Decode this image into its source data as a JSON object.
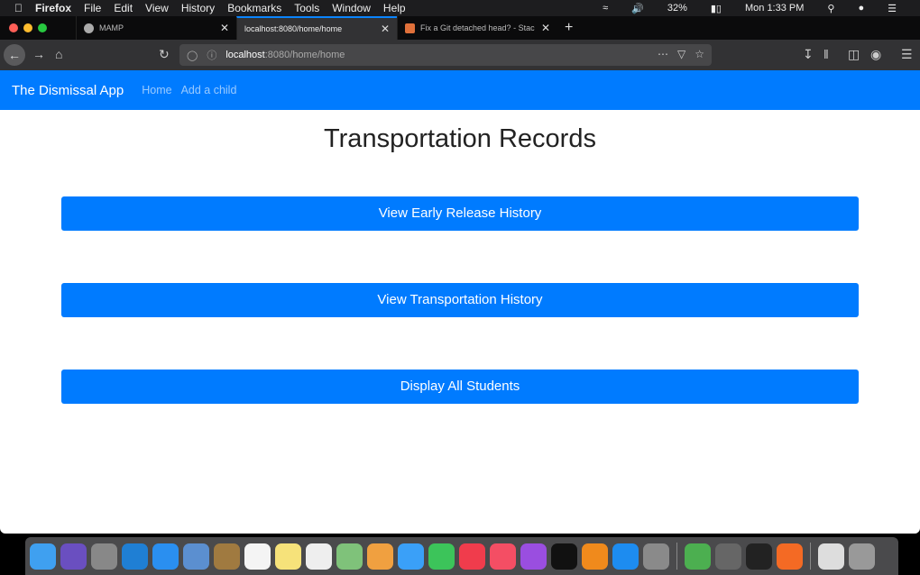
{
  "menubar": {
    "items": [
      "Firefox",
      "File",
      "Edit",
      "View",
      "History",
      "Bookmarks",
      "Tools",
      "Window",
      "Help"
    ],
    "battery": "32%",
    "clock": "Mon 1:33 PM"
  },
  "tabs": [
    {
      "label": "MAMP"
    },
    {
      "label": "localhost:8080/home/home",
      "active": true
    },
    {
      "label": "Fix a Git detached head? - Stac"
    }
  ],
  "url": {
    "host": "localhost",
    "path": ":8080/home/home"
  },
  "navbar": {
    "brand": "The Dismissal App",
    "links": [
      "Home",
      "Add a child"
    ]
  },
  "main": {
    "title": "Transportation Records",
    "buttons": [
      "View Early Release History",
      "View Transportation History",
      "Display All Students"
    ]
  },
  "colors": {
    "primary": "#007bff",
    "heading": "#222222"
  },
  "dock": {
    "apps": [
      {
        "icon": "finder-icon",
        "color": "#3fa0f0"
      },
      {
        "icon": "siri-icon",
        "color": "#6a4fc0"
      },
      {
        "icon": "launchpad-icon",
        "color": "#888"
      },
      {
        "icon": "vscode-icon",
        "color": "#1f7fd4"
      },
      {
        "icon": "safari-icon",
        "color": "#2a8ff0"
      },
      {
        "icon": "preview-icon",
        "color": "#5b8fd0"
      },
      {
        "icon": "notefile-icon",
        "color": "#a07a40"
      },
      {
        "icon": "calendar-icon",
        "color": "#f4f4f4"
      },
      {
        "icon": "notes-icon",
        "color": "#f6e27a"
      },
      {
        "icon": "reminders-icon",
        "color": "#eee"
      },
      {
        "icon": "maps-icon",
        "color": "#7fc27a"
      },
      {
        "icon": "photos-icon",
        "color": "#f0a040"
      },
      {
        "icon": "messages-icon",
        "color": "#3aa0f8"
      },
      {
        "icon": "facetime-icon",
        "color": "#3cc45a"
      },
      {
        "icon": "news-icon",
        "color": "#f03c4c"
      },
      {
        "icon": "music-icon",
        "color": "#f44e64"
      },
      {
        "icon": "podcasts-icon",
        "color": "#9a4ee0"
      },
      {
        "icon": "appletv-icon",
        "color": "#111"
      },
      {
        "icon": "books-icon",
        "color": "#f08a1c"
      },
      {
        "icon": "appstore-icon",
        "color": "#1d8cf0"
      },
      {
        "icon": "system-preferences-icon",
        "color": "#8a8a8a"
      },
      {
        "icon": "chrome-icon",
        "color": "#4caf50"
      },
      {
        "icon": "mamp-icon",
        "color": "#666"
      },
      {
        "icon": "intellij-icon",
        "color": "#222"
      },
      {
        "icon": "firefox-icon",
        "color": "#f46a24"
      },
      {
        "icon": "documents-icon",
        "color": "#ddd"
      },
      {
        "icon": "trash-icon",
        "color": "#999"
      }
    ]
  }
}
